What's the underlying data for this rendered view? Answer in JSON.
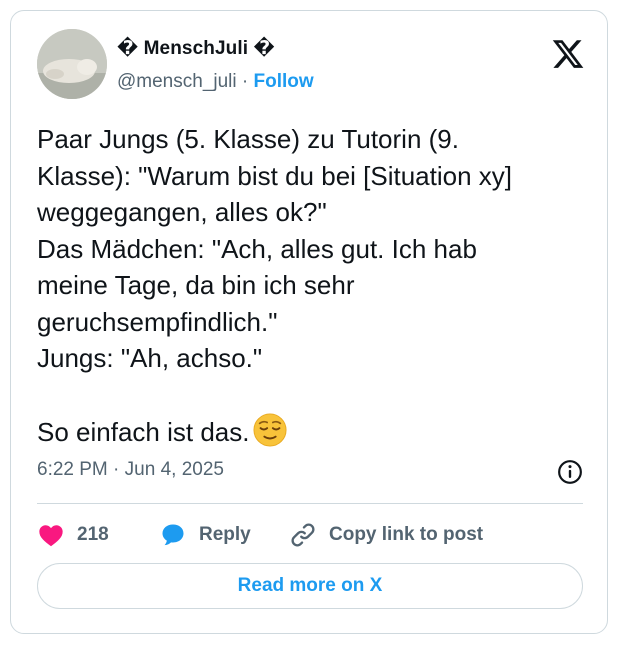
{
  "author": {
    "display_name": "� MenschJuli �",
    "handle": "@mensch_juli",
    "separator": " · ",
    "follow_label": "Follow"
  },
  "tweet": {
    "text": "Paar Jungs (5. Klasse) zu Tutorin (9.\nKlasse): \"Warum bist du bei [Situation xy]\nweggegangen, alles ok?\"\nDas Mädchen: \"Ach, alles gut. Ich hab\nmeine Tage, da bin ich sehr\ngeruchsempfindlich.\"\nJungs: \"Ah, achso.\"\n\nSo einfach ist das.",
    "emoji": "relieved-face"
  },
  "meta": {
    "time": "6:22 PM",
    "separator": " · ",
    "date": "Jun 4, 2025"
  },
  "actions": {
    "like_count": "218",
    "reply_label": "Reply",
    "copy_label": "Copy link to post"
  },
  "read_more_label": "Read more on X",
  "colors": {
    "accent": "#1d9bf0",
    "like": "#f91880",
    "border": "#cfd9de",
    "muted": "#536471",
    "emoji": "#f8c33a"
  }
}
